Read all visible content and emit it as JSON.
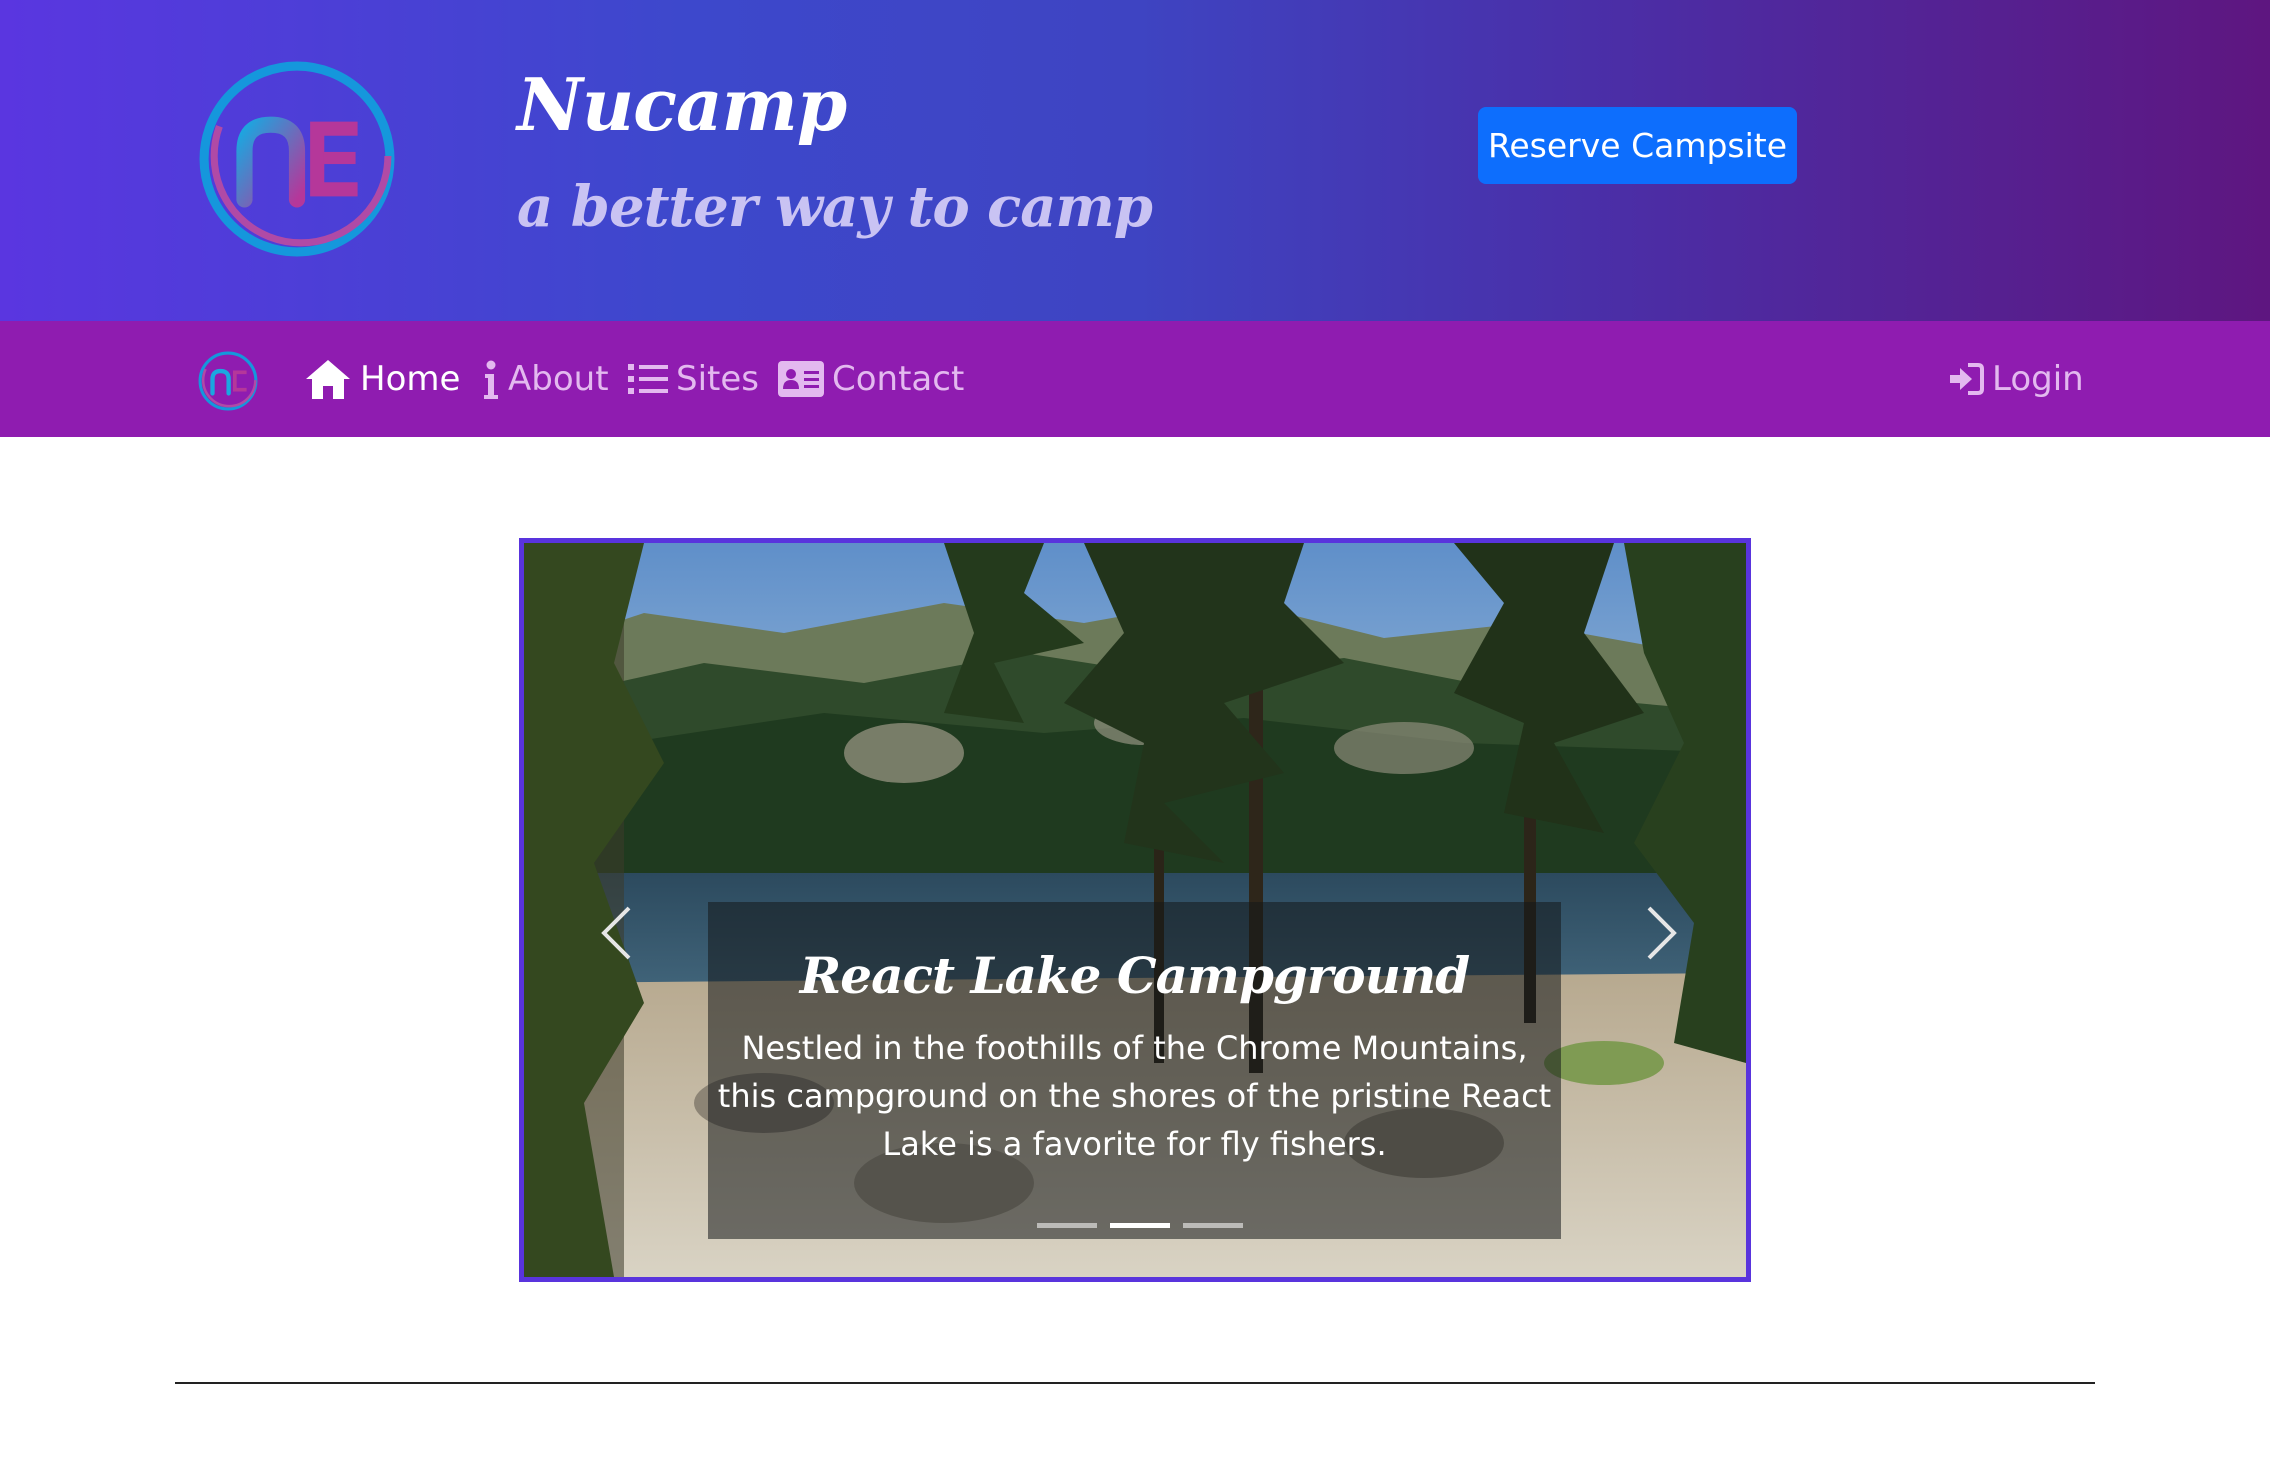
{
  "header": {
    "logo_icon": "nucamp-logo",
    "title": "Nucamp",
    "tagline": "a better way to camp",
    "reserve_label": "Reserve Campsite"
  },
  "navbar": {
    "items": [
      {
        "label": "Home",
        "icon": "home-icon",
        "active": true
      },
      {
        "label": "About",
        "icon": "info-icon",
        "active": false
      },
      {
        "label": "Sites",
        "icon": "list-icon",
        "active": false
      },
      {
        "label": "Contact",
        "icon": "address-card-icon",
        "active": false
      }
    ],
    "login_label": "Login",
    "login_icon": "sign-in-icon"
  },
  "carousel": {
    "slide": {
      "title": "React Lake Campground",
      "text": "Nestled in the foothills of the Chrome Mountains, this campground on the shores of the pristine React Lake is a favorite for fly fishers."
    },
    "indicators": 3,
    "active_indicator": 2
  },
  "colors": {
    "header_gradient_start": "#5a36e0",
    "header_gradient_end": "#5e1680",
    "navbar_bg": "#8f1cb0",
    "reserve_button": "#0d6efd",
    "carousel_border": "#5934dd"
  }
}
